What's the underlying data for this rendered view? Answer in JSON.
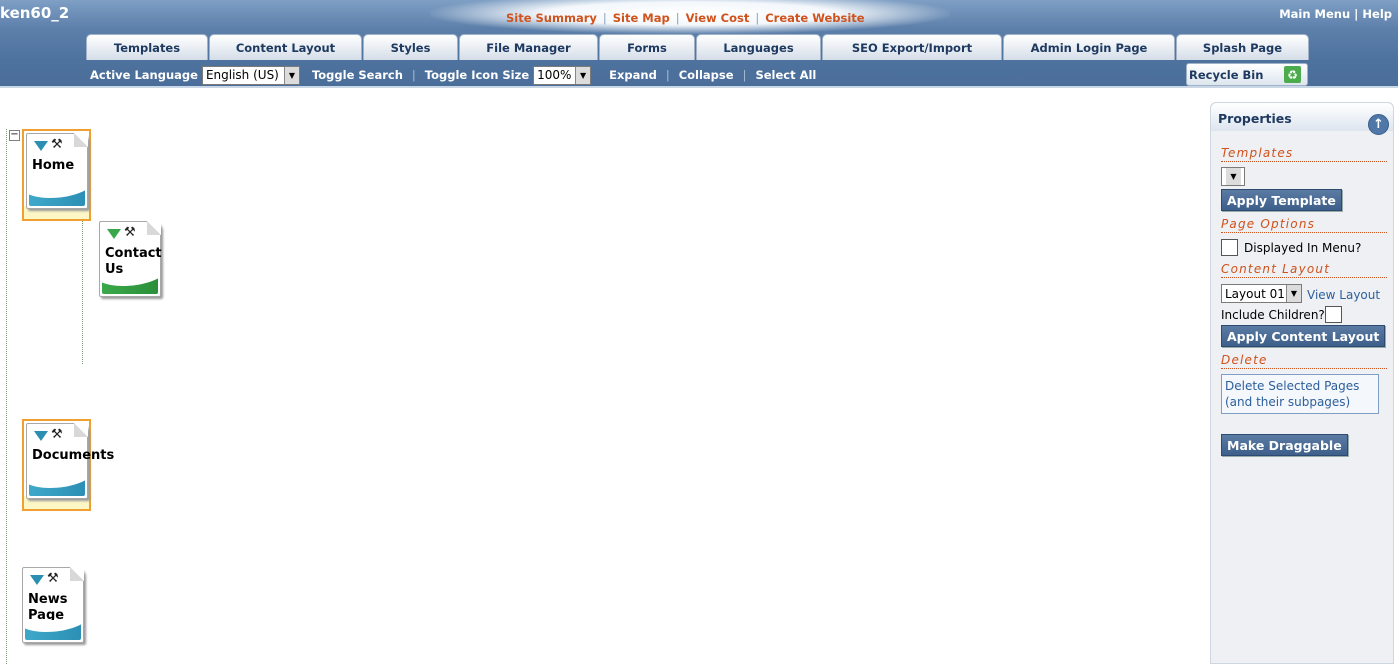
{
  "site": {
    "name": "ken60_2"
  },
  "top_links": [
    "Site Summary",
    "Site Map",
    "View Cost",
    "Create Website"
  ],
  "right_links": {
    "main_menu": "Main Menu",
    "separator": "|",
    "help": "Help"
  },
  "tabs": [
    "Templates",
    "Content Layout",
    "Styles",
    "File Manager",
    "Forms",
    "Languages",
    "SEO Export/Import",
    "Admin Login Page",
    "Splash Page"
  ],
  "toolbar": {
    "active_language_label": "Active Language",
    "active_language_value": "English (US)",
    "toggle_search": "Toggle Search",
    "toggle_icon_size": "Toggle Icon Size",
    "icon_size_value": "100%",
    "expand": "Expand",
    "collapse": "Collapse",
    "select_all": "Select All",
    "recycle_bin": "Recycle Bin"
  },
  "tree": {
    "collapse_symbol": "−",
    "nodes": {
      "home": "Home",
      "contact_line1": "Contact",
      "contact_line2": "Us",
      "documents": "Documents",
      "news_line1": "News",
      "news_line2": "Page"
    }
  },
  "properties": {
    "title": "Properties",
    "templates_title": "Templates",
    "apply_template": "Apply Template",
    "page_options_title": "Page Options",
    "displayed_in_menu": "Displayed In Menu?",
    "content_layout_title": "Content Layout",
    "layout_value": "Layout 01",
    "view_layout": "View Layout",
    "include_children": "Include Children?",
    "apply_content_layout": "Apply Content Layout",
    "delete_title": "Delete",
    "delete_line1": "Delete Selected Pages",
    "delete_line2": "(and their subpages)",
    "make_draggable": "Make Draggable"
  },
  "colors": {
    "accent_orange": "#d0521c",
    "header_blue": "#5d80ab",
    "selection_orange": "#f0a030"
  }
}
